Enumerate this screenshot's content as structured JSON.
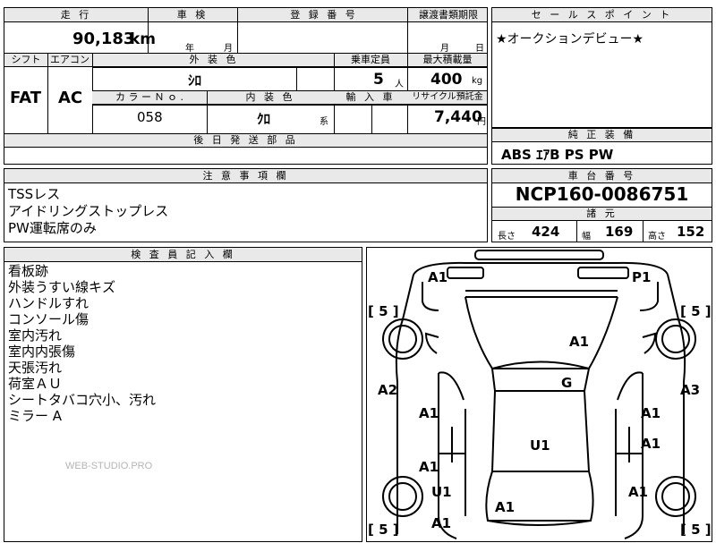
{
  "top_table": {
    "mileage_label": "走 行",
    "mileage_value": "90,183",
    "mileage_unit": "km",
    "inspection_label": "車 検",
    "inspection_year_unit": "年",
    "inspection_month_unit": "月",
    "registration_label": "登 録 番 号",
    "transfer_deadline_label": "譲渡書類期限",
    "transfer_month_unit": "月",
    "transfer_day_unit": "日",
    "shift_label": "シフト",
    "shift_value": "FAT",
    "aircon_label": "エアコン",
    "aircon_value": "AC",
    "exterior_color_label": "外 装 色",
    "exterior_color_value": "ｼﾛ",
    "capacity_label": "乗車定員",
    "capacity_value": "5",
    "capacity_unit": "人",
    "max_load_label": "最大積載量",
    "max_load_value": "400",
    "max_load_unit": "kg",
    "color_no_label": "カ ラ ー Ｎ ｏ .",
    "color_no_value": "058",
    "interior_color_label": "内 装 色",
    "interior_color_value": "ｸﾛ",
    "interior_suffix": "系",
    "import_label": "輸 入 車",
    "recycle_label": "リサイクル預託金",
    "recycle_value": "7,440",
    "recycle_unit": "円",
    "parts_label": "後 日 発 送 部 品"
  },
  "sales_point": {
    "label": "セ ー ル ス ポ イ ン ト",
    "text": "★オークションデビュー★"
  },
  "equipment": {
    "label": "純 正 装 備",
    "text": "ABS ｴｱB PS PW"
  },
  "caution": {
    "label": "注 意 事 項 欄",
    "lines": [
      "TSSレス",
      "アイドリングストップレス",
      "PW運転席のみ"
    ]
  },
  "chassis": {
    "label": "車 台 番 号",
    "value": "NCP160-0086751"
  },
  "specs": {
    "label": "諸 元",
    "length_label": "長さ",
    "length_value": "424",
    "width_label": "幅",
    "width_value": "169",
    "height_label": "高さ",
    "height_value": "152"
  },
  "inspector": {
    "label": "検 査 員 記 入 欄",
    "lines": [
      "看板跡",
      "外装うすい線キズ",
      "ハンドルすれ",
      "コンソール傷",
      "室内汚れ",
      "室内内張傷",
      "天張汚れ",
      "荷室ＡＵ",
      "シートタバコ穴小、汚れ",
      "ミラー A"
    ],
    "watermark": "WEB-STUDIO.PRO"
  },
  "diagram_marks": {
    "front_left": "A1",
    "front_right": "P1",
    "hood": "A1",
    "roof_front": "G",
    "left_fender": "A2",
    "right_fender": "A3",
    "left_door_front": "A1",
    "right_door_front": "A1",
    "roof": "U1",
    "right_door_rear": "A1",
    "left_door_rear": "A1",
    "left_quarter": "U1",
    "right_quarter": "A1",
    "rear_left": "A1",
    "rear_center": "A1",
    "rear_bottom_left": "A1",
    "tire_fl": "[ 5 ]",
    "tire_fr": "[ 5 ]",
    "tire_rl": "[ 5 ]",
    "tire_rr": "[ 5 ]"
  }
}
